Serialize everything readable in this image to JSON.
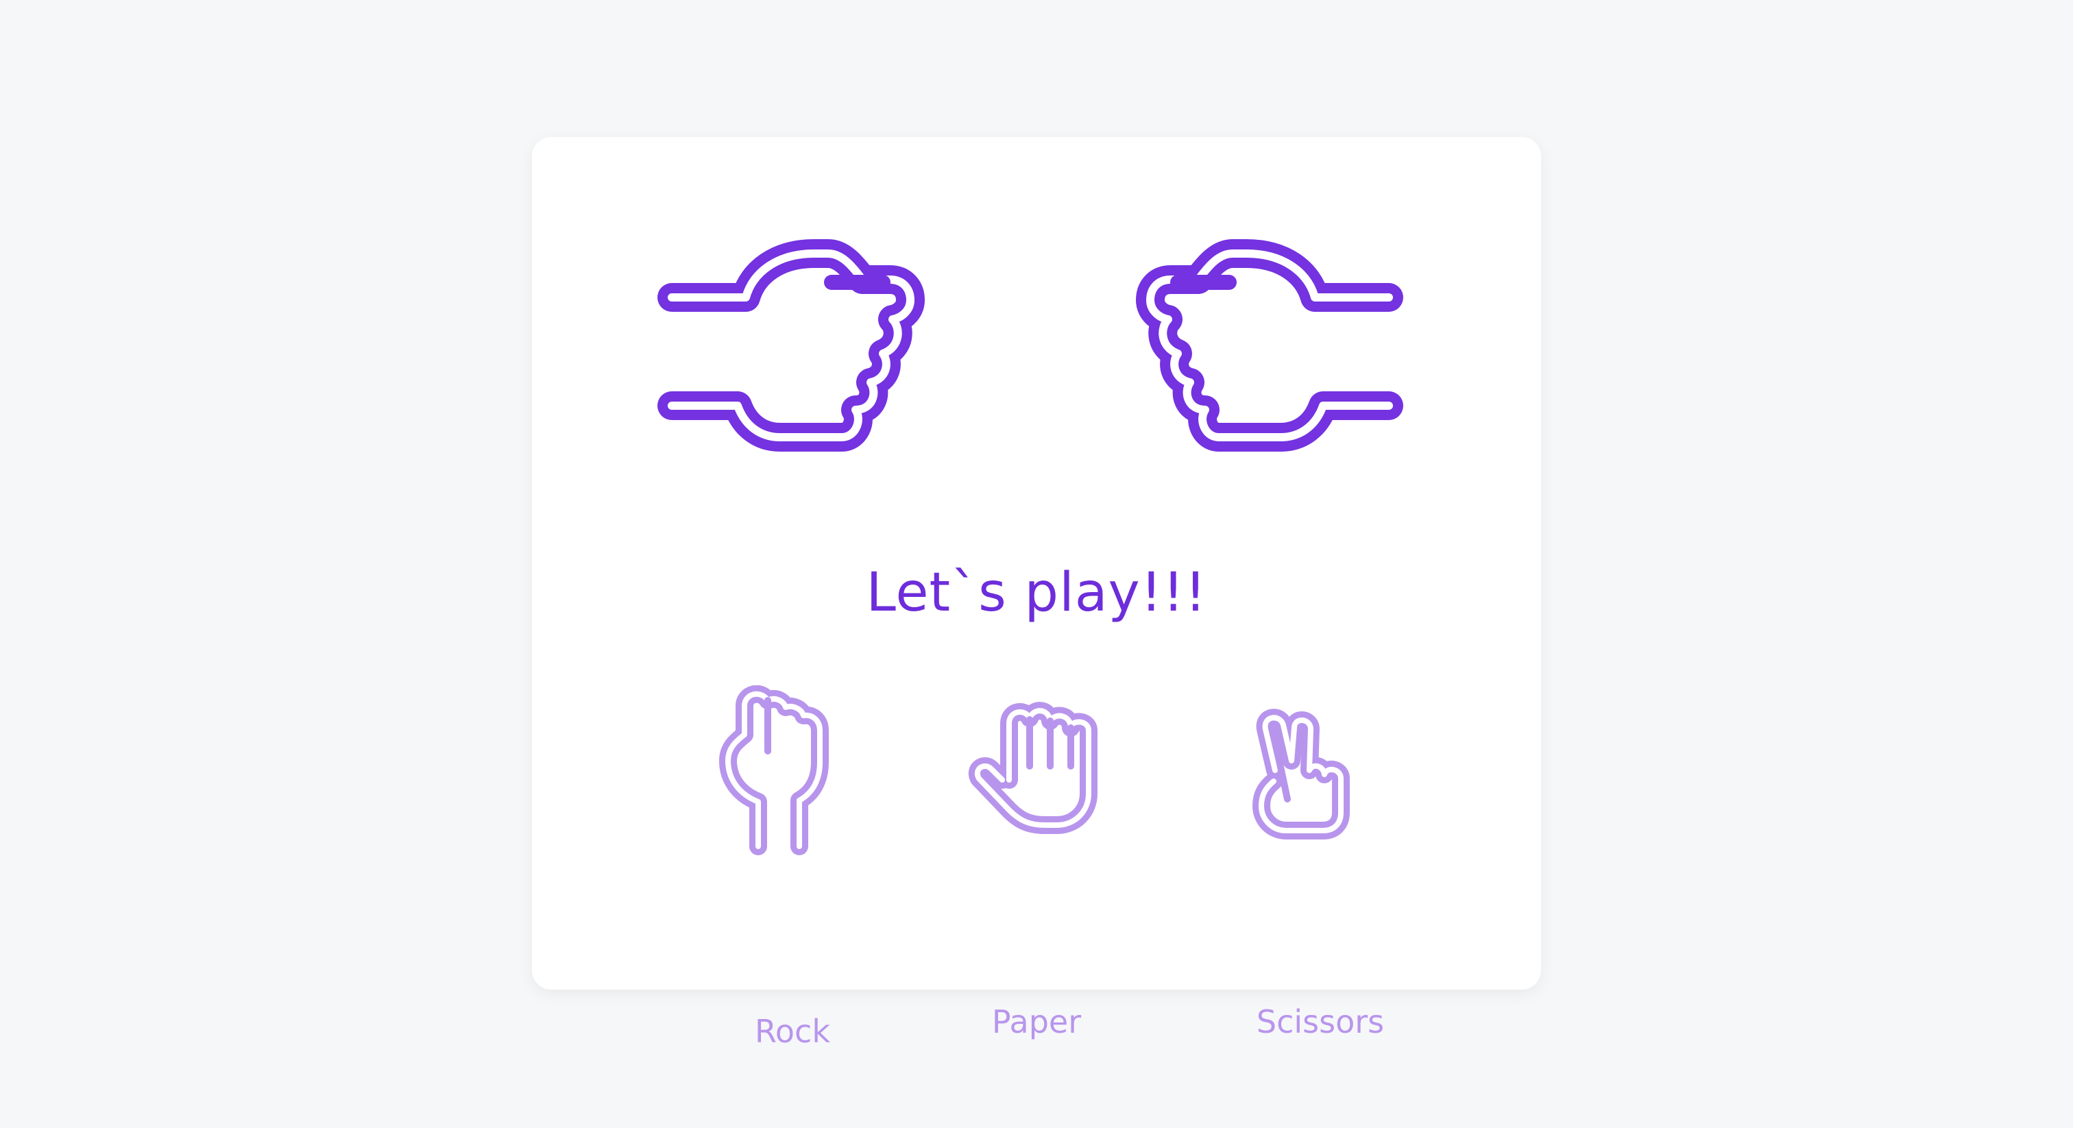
{
  "game": {
    "headline": "Let`s play!!!"
  },
  "choices": [
    {
      "label": "Rock",
      "icon": "rock-fist-icon"
    },
    {
      "label": "Paper",
      "icon": "paper-hand-icon"
    },
    {
      "label": "Scissors",
      "icon": "scissors-hand-icon"
    }
  ],
  "colors": {
    "background": "#f6f7f9",
    "card": "#ffffff",
    "primary": "#6d2ddb",
    "muted": "#b895ec"
  }
}
